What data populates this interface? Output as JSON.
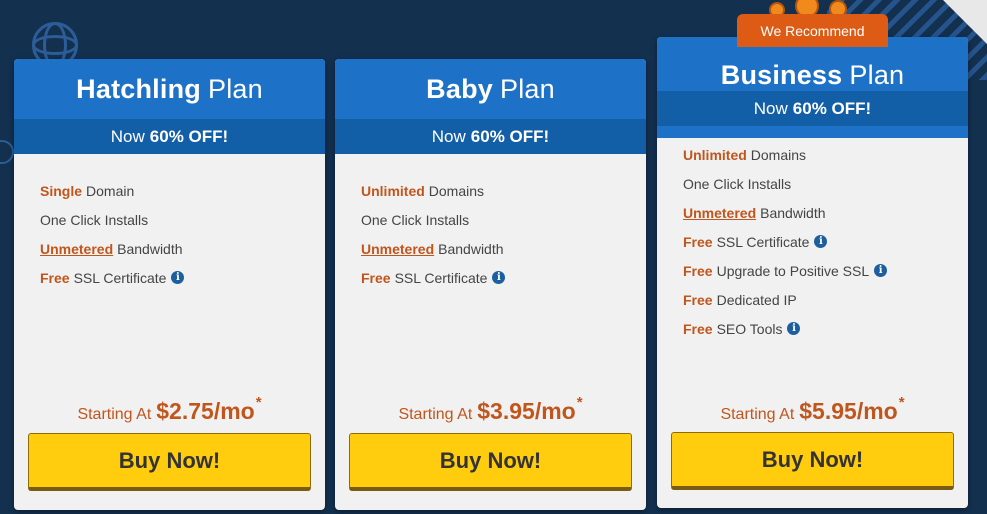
{
  "recommend_badge": "We Recommend",
  "plans": [
    {
      "name_bold": "Hatchling",
      "name_rest": "Plan",
      "discount_prefix": "Now",
      "discount_value": "60% OFF!",
      "features": [
        {
          "hl": "Single",
          "underline": false,
          "text": "Domain",
          "info": false
        },
        {
          "hl": "",
          "underline": false,
          "text": "One Click Installs",
          "info": false
        },
        {
          "hl": "Unmetered",
          "underline": true,
          "text": "Bandwidth",
          "info": false
        },
        {
          "hl": "Free",
          "underline": false,
          "text": "SSL Certificate",
          "info": true
        }
      ],
      "price_label": "Starting At",
      "price": "$2.75/mo",
      "price_mark": "*",
      "buy_label": "Buy Now!"
    },
    {
      "name_bold": "Baby",
      "name_rest": "Plan",
      "discount_prefix": "Now",
      "discount_value": "60% OFF!",
      "features": [
        {
          "hl": "Unlimited",
          "underline": false,
          "text": "Domains",
          "info": false
        },
        {
          "hl": "",
          "underline": false,
          "text": "One Click Installs",
          "info": false
        },
        {
          "hl": "Unmetered",
          "underline": true,
          "text": "Bandwidth",
          "info": false
        },
        {
          "hl": "Free",
          "underline": false,
          "text": "SSL Certificate",
          "info": true
        }
      ],
      "price_label": "Starting At",
      "price": "$3.95/mo",
      "price_mark": "*",
      "buy_label": "Buy Now!"
    },
    {
      "name_bold": "Business",
      "name_rest": "Plan",
      "discount_prefix": "Now",
      "discount_value": "60% OFF!",
      "features": [
        {
          "hl": "Unlimited",
          "underline": false,
          "text": "Domains",
          "info": false
        },
        {
          "hl": "",
          "underline": false,
          "text": "One Click Installs",
          "info": false
        },
        {
          "hl": "Unmetered",
          "underline": true,
          "text": "Bandwidth",
          "info": false
        },
        {
          "hl": "Free",
          "underline": false,
          "text": "SSL Certificate",
          "info": true
        },
        {
          "hl": "Free",
          "underline": false,
          "text": "Upgrade to Positive SSL",
          "info": true
        },
        {
          "hl": "Free",
          "underline": false,
          "text": "Dedicated IP",
          "info": false
        },
        {
          "hl": "Free",
          "underline": false,
          "text": "SEO Tools",
          "info": true
        }
      ],
      "price_label": "Starting At",
      "price": "$5.95/mo",
      "price_mark": "*",
      "buy_label": "Buy Now!"
    }
  ],
  "icons": {
    "info": "info-circle-icon",
    "background": [
      "globe-icon",
      "lightbulb-icon",
      "coins-icon"
    ]
  },
  "colors": {
    "background": "#13304f",
    "header_blue": "#1d72c7",
    "discount_blue": "#125ea7",
    "accent_orange": "#c1561d",
    "badge_orange": "#dd5b14",
    "button_yellow": "#ffcd0d"
  }
}
